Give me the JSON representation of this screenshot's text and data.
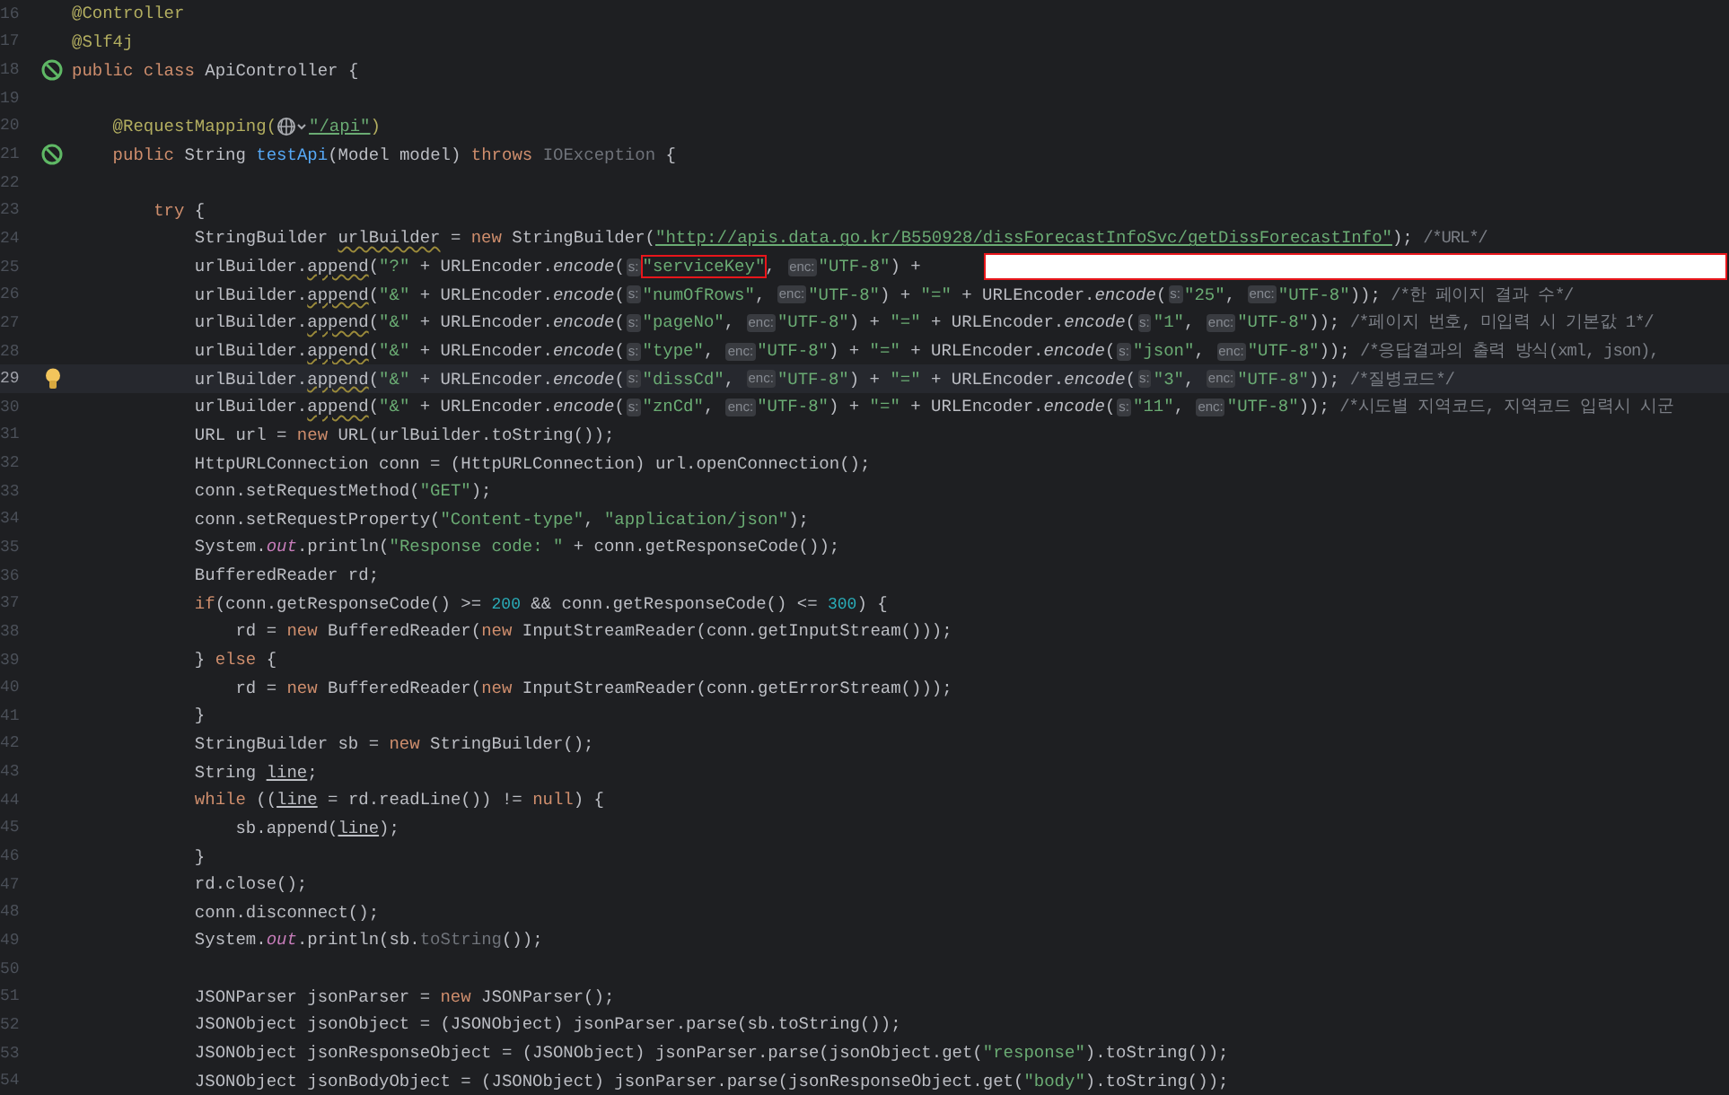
{
  "editor": {
    "lines": [
      {
        "number": "16",
        "current": false,
        "tokens": [
          {
            "kind": "ann",
            "text": "@Controller"
          }
        ]
      },
      {
        "number": "17",
        "current": false,
        "tokens": [
          {
            "kind": "ann",
            "text": "@Slf4j"
          }
        ]
      },
      {
        "number": "18",
        "current": false,
        "kind": "bean",
        "tokens": [
          {
            "kind": "kw",
            "text": "public class "
          },
          {
            "kind": "plain",
            "text": "ApiController {"
          }
        ]
      },
      {
        "number": "19",
        "current": false
      },
      {
        "number": "20",
        "current": false,
        "tokens": [
          {
            "kind": "ann",
            "text": "    @RequestMapping("
          },
          {
            "kind": "globe"
          },
          {
            "kind": "link",
            "text": "\"/api\""
          },
          {
            "kind": "ann",
            "text": ")"
          }
        ]
      },
      {
        "number": "21",
        "current": false,
        "kind": "bean",
        "tokens": [
          {
            "kind": "kw",
            "text": "    public "
          },
          {
            "kind": "plain",
            "text": "String "
          },
          {
            "kind": "fn",
            "text": "testApi"
          },
          {
            "kind": "plain",
            "text": "(Model model) "
          },
          {
            "kind": "kw",
            "text": "throws "
          },
          {
            "kind": "dim",
            "text": "IOException"
          },
          {
            "kind": "plain",
            "text": " {"
          }
        ]
      },
      {
        "number": "22",
        "current": false
      },
      {
        "number": "23",
        "current": false,
        "tokens": [
          {
            "kind": "kw",
            "text": "        try "
          },
          {
            "kind": "plain",
            "text": "{"
          }
        ]
      },
      {
        "number": "24",
        "current": false,
        "tokens": [
          {
            "kind": "plain",
            "text": "            StringBuilder "
          },
          {
            "kind": "warn",
            "text": "urlBuilder"
          },
          {
            "kind": "plain",
            "text": " = "
          },
          {
            "kind": "kw",
            "text": "new "
          },
          {
            "kind": "plain",
            "text": "StringBuilder("
          },
          {
            "kind": "link",
            "text": "\"http://apis.data.go.kr/B550928/dissForecastInfoSvc/getDissForecastInfo\""
          },
          {
            "kind": "plain",
            "text": "); "
          },
          {
            "kind": "com",
            "text": "/*URL*/"
          }
        ]
      },
      {
        "number": "25",
        "current": false,
        "redacted": true,
        "tokens": [
          {
            "kind": "plain",
            "text": "            urlBuilder."
          },
          {
            "kind": "warn",
            "text": "append"
          },
          {
            "kind": "plain",
            "text": "("
          },
          {
            "kind": "str",
            "text": "\"?\""
          },
          {
            "kind": "plain",
            "text": " + URLEncoder."
          },
          {
            "kind": "static",
            "text": "encode"
          },
          {
            "kind": "plain",
            "text": "("
          },
          {
            "kind": "hint",
            "text": "s:"
          },
          {
            "kind": "boxed",
            "text": "\"serviceKey\""
          },
          {
            "kind": "plain",
            "text": ", "
          },
          {
            "kind": "hint",
            "text": "enc:"
          },
          {
            "kind": "str",
            "text": "\"UTF-8\""
          },
          {
            "kind": "plain",
            "text": ") + "
          }
        ]
      },
      {
        "number": "26",
        "current": false,
        "tokens": [
          {
            "kind": "plain",
            "text": "            urlBuilder."
          },
          {
            "kind": "warn",
            "text": "append"
          },
          {
            "kind": "plain",
            "text": "("
          },
          {
            "kind": "str",
            "text": "\"&\""
          },
          {
            "kind": "plain",
            "text": " + URLEncoder."
          },
          {
            "kind": "static",
            "text": "encode"
          },
          {
            "kind": "plain",
            "text": "("
          },
          {
            "kind": "hint",
            "text": "s:"
          },
          {
            "kind": "str",
            "text": "\"numOfRows\""
          },
          {
            "kind": "plain",
            "text": ", "
          },
          {
            "kind": "hint",
            "text": "enc:"
          },
          {
            "kind": "str",
            "text": "\"UTF-8\""
          },
          {
            "kind": "plain",
            "text": ") + "
          },
          {
            "kind": "str",
            "text": "\"=\""
          },
          {
            "kind": "plain",
            "text": " + URLEncoder."
          },
          {
            "kind": "static",
            "text": "encode"
          },
          {
            "kind": "plain",
            "text": "("
          },
          {
            "kind": "hint",
            "text": "s:"
          },
          {
            "kind": "str",
            "text": "\"25\""
          },
          {
            "kind": "plain",
            "text": ", "
          },
          {
            "kind": "hint",
            "text": "enc:"
          },
          {
            "kind": "str",
            "text": "\"UTF-8\""
          },
          {
            "kind": "plain",
            "text": ")); "
          },
          {
            "kind": "com",
            "text": "/*한 페이지 결과 수*/"
          }
        ]
      },
      {
        "number": "27",
        "current": false,
        "tokens": [
          {
            "kind": "plain",
            "text": "            urlBuilder."
          },
          {
            "kind": "warn",
            "text": "append"
          },
          {
            "kind": "plain",
            "text": "("
          },
          {
            "kind": "str",
            "text": "\"&\""
          },
          {
            "kind": "plain",
            "text": " + URLEncoder."
          },
          {
            "kind": "static",
            "text": "encode"
          },
          {
            "kind": "plain",
            "text": "("
          },
          {
            "kind": "hint",
            "text": "s:"
          },
          {
            "kind": "str",
            "text": "\"pageNo\""
          },
          {
            "kind": "plain",
            "text": ", "
          },
          {
            "kind": "hint",
            "text": "enc:"
          },
          {
            "kind": "str",
            "text": "\"UTF-8\""
          },
          {
            "kind": "plain",
            "text": ") + "
          },
          {
            "kind": "str",
            "text": "\"=\""
          },
          {
            "kind": "plain",
            "text": " + URLEncoder."
          },
          {
            "kind": "static",
            "text": "encode"
          },
          {
            "kind": "plain",
            "text": "("
          },
          {
            "kind": "hint",
            "text": "s:"
          },
          {
            "kind": "str",
            "text": "\"1\""
          },
          {
            "kind": "plain",
            "text": ", "
          },
          {
            "kind": "hint",
            "text": "enc:"
          },
          {
            "kind": "str",
            "text": "\"UTF-8\""
          },
          {
            "kind": "plain",
            "text": ")); "
          },
          {
            "kind": "com",
            "text": "/*페이지 번호, 미입력 시 기본값 1*/"
          }
        ]
      },
      {
        "number": "28",
        "current": false,
        "tokens": [
          {
            "kind": "plain",
            "text": "            urlBuilder."
          },
          {
            "kind": "warn",
            "text": "append"
          },
          {
            "kind": "plain",
            "text": "("
          },
          {
            "kind": "str",
            "text": "\"&\""
          },
          {
            "kind": "plain",
            "text": " + URLEncoder."
          },
          {
            "kind": "static",
            "text": "encode"
          },
          {
            "kind": "plain",
            "text": "("
          },
          {
            "kind": "hint",
            "text": "s:"
          },
          {
            "kind": "str",
            "text": "\"type\""
          },
          {
            "kind": "plain",
            "text": ", "
          },
          {
            "kind": "hint",
            "text": "enc:"
          },
          {
            "kind": "str",
            "text": "\"UTF-8\""
          },
          {
            "kind": "plain",
            "text": ") + "
          },
          {
            "kind": "str",
            "text": "\"=\""
          },
          {
            "kind": "plain",
            "text": " + URLEncoder."
          },
          {
            "kind": "static",
            "text": "encode"
          },
          {
            "kind": "plain",
            "text": "("
          },
          {
            "kind": "hint",
            "text": "s:"
          },
          {
            "kind": "str",
            "text": "\"json\""
          },
          {
            "kind": "plain",
            "text": ", "
          },
          {
            "kind": "hint",
            "text": "enc:"
          },
          {
            "kind": "str",
            "text": "\"UTF-8\""
          },
          {
            "kind": "plain",
            "text": ")); "
          },
          {
            "kind": "com",
            "text": "/*응답결과의 출력 방식(xml, json),"
          }
        ]
      },
      {
        "number": "29",
        "current": true,
        "kind": "bulb",
        "tokens": [
          {
            "kind": "plain",
            "text": "            urlBuilder."
          },
          {
            "kind": "warn",
            "text": "append"
          },
          {
            "kind": "plain",
            "text": "("
          },
          {
            "kind": "str",
            "text": "\"&\""
          },
          {
            "kind": "plain",
            "text": " + URLEncoder."
          },
          {
            "kind": "static",
            "text": "encode"
          },
          {
            "kind": "plain",
            "text": "("
          },
          {
            "kind": "hint",
            "text": "s:"
          },
          {
            "kind": "str",
            "text": "\"dissCd\""
          },
          {
            "kind": "plain",
            "text": ", "
          },
          {
            "kind": "hint",
            "text": "enc:"
          },
          {
            "kind": "str",
            "text": "\"UTF-8\""
          },
          {
            "kind": "plain",
            "text": ") + "
          },
          {
            "kind": "str",
            "text": "\"=\""
          },
          {
            "kind": "plain",
            "text": " + URLEncoder."
          },
          {
            "kind": "static",
            "text": "encode"
          },
          {
            "kind": "plain",
            "text": "("
          },
          {
            "kind": "hint",
            "text": "s:"
          },
          {
            "kind": "str",
            "text": "\"3\""
          },
          {
            "kind": "plain",
            "text": ", "
          },
          {
            "kind": "hint",
            "text": "enc:"
          },
          {
            "kind": "str",
            "text": "\"UTF-8\""
          },
          {
            "kind": "plain",
            "text": ")); "
          },
          {
            "kind": "com",
            "text": "/*질병코드*/"
          }
        ]
      },
      {
        "number": "30",
        "current": false,
        "tokens": [
          {
            "kind": "plain",
            "text": "            urlBuilder."
          },
          {
            "kind": "warn",
            "text": "append"
          },
          {
            "kind": "plain",
            "text": "("
          },
          {
            "kind": "str",
            "text": "\"&\""
          },
          {
            "kind": "plain",
            "text": " + URLEncoder."
          },
          {
            "kind": "static",
            "text": "encode"
          },
          {
            "kind": "plain",
            "text": "("
          },
          {
            "kind": "hint",
            "text": "s:"
          },
          {
            "kind": "str",
            "text": "\"znCd\""
          },
          {
            "kind": "plain",
            "text": ", "
          },
          {
            "kind": "hint",
            "text": "enc:"
          },
          {
            "kind": "str",
            "text": "\"UTF-8\""
          },
          {
            "kind": "plain",
            "text": ") + "
          },
          {
            "kind": "str",
            "text": "\"=\""
          },
          {
            "kind": "plain",
            "text": " + URLEncoder."
          },
          {
            "kind": "static",
            "text": "encode"
          },
          {
            "kind": "plain",
            "text": "("
          },
          {
            "kind": "hint",
            "text": "s:"
          },
          {
            "kind": "str",
            "text": "\"11\""
          },
          {
            "kind": "plain",
            "text": ", "
          },
          {
            "kind": "hint",
            "text": "enc:"
          },
          {
            "kind": "str",
            "text": "\"UTF-8\""
          },
          {
            "kind": "plain",
            "text": ")); "
          },
          {
            "kind": "com",
            "text": "/*시도별 지역코드, 지역코드 입력시 시군"
          }
        ]
      },
      {
        "number": "31",
        "current": false,
        "tokens": [
          {
            "kind": "plain",
            "text": "            URL url = "
          },
          {
            "kind": "kw",
            "text": "new "
          },
          {
            "kind": "plain",
            "text": "URL(urlBuilder.toString());"
          }
        ]
      },
      {
        "number": "32",
        "current": false,
        "tokens": [
          {
            "kind": "plain",
            "text": "            HttpURLConnection conn = (HttpURLConnection) url.openConnection();"
          }
        ]
      },
      {
        "number": "33",
        "current": false,
        "tokens": [
          {
            "kind": "plain",
            "text": "            conn.setRequestMethod("
          },
          {
            "kind": "str",
            "text": "\"GET\""
          },
          {
            "kind": "plain",
            "text": ");"
          }
        ]
      },
      {
        "number": "34",
        "current": false,
        "tokens": [
          {
            "kind": "plain",
            "text": "            conn.setRequestProperty("
          },
          {
            "kind": "str",
            "text": "\"Content-type\""
          },
          {
            "kind": "plain",
            "text": ", "
          },
          {
            "kind": "str",
            "text": "\"application/json\""
          },
          {
            "kind": "plain",
            "text": ");"
          }
        ]
      },
      {
        "number": "35",
        "current": false,
        "tokens": [
          {
            "kind": "plain",
            "text": "            System."
          },
          {
            "kind": "field",
            "text": "out"
          },
          {
            "kind": "plain",
            "text": ".println("
          },
          {
            "kind": "str",
            "text": "\"Response code: \""
          },
          {
            "kind": "plain",
            "text": " + conn.getResponseCode());"
          }
        ]
      },
      {
        "number": "36",
        "current": false,
        "tokens": [
          {
            "kind": "plain",
            "text": "            BufferedReader rd;"
          }
        ]
      },
      {
        "number": "37",
        "current": false,
        "tokens": [
          {
            "kind": "kw",
            "text": "            if"
          },
          {
            "kind": "plain",
            "text": "(conn.getResponseCode() >= "
          },
          {
            "kind": "num",
            "text": "200"
          },
          {
            "kind": "plain",
            "text": " && conn.getResponseCode() <= "
          },
          {
            "kind": "num",
            "text": "300"
          },
          {
            "kind": "plain",
            "text": ") {"
          }
        ]
      },
      {
        "number": "38",
        "current": false,
        "tokens": [
          {
            "kind": "plain",
            "text": "                rd = "
          },
          {
            "kind": "kw",
            "text": "new "
          },
          {
            "kind": "plain",
            "text": "BufferedReader("
          },
          {
            "kind": "kw",
            "text": "new "
          },
          {
            "kind": "plain",
            "text": "InputStreamReader(conn.getInputStream()));"
          }
        ]
      },
      {
        "number": "39",
        "current": false,
        "tokens": [
          {
            "kind": "plain",
            "text": "            } "
          },
          {
            "kind": "kw",
            "text": "else "
          },
          {
            "kind": "plain",
            "text": "{"
          }
        ]
      },
      {
        "number": "40",
        "current": false,
        "tokens": [
          {
            "kind": "plain",
            "text": "                rd = "
          },
          {
            "kind": "kw",
            "text": "new "
          },
          {
            "kind": "plain",
            "text": "BufferedReader("
          },
          {
            "kind": "kw",
            "text": "new "
          },
          {
            "kind": "plain",
            "text": "InputStreamReader(conn.getErrorStream()));"
          }
        ]
      },
      {
        "number": "41",
        "current": false,
        "tokens": [
          {
            "kind": "plain",
            "text": "            }"
          }
        ]
      },
      {
        "number": "42",
        "current": false,
        "tokens": [
          {
            "kind": "plain",
            "text": "            StringBuilder sb = "
          },
          {
            "kind": "kw",
            "text": "new "
          },
          {
            "kind": "plain",
            "text": "StringBuilder();"
          }
        ]
      },
      {
        "number": "43",
        "current": false,
        "tokens": [
          {
            "kind": "plain",
            "text": "            String "
          },
          {
            "kind": "ul",
            "text": "line"
          },
          {
            "kind": "plain",
            "text": ";"
          }
        ]
      },
      {
        "number": "44",
        "current": false,
        "tokens": [
          {
            "kind": "kw",
            "text": "            while "
          },
          {
            "kind": "plain",
            "text": "(("
          },
          {
            "kind": "ul",
            "text": "line"
          },
          {
            "kind": "plain",
            "text": " = rd.readLine()) != "
          },
          {
            "kind": "kw",
            "text": "null"
          },
          {
            "kind": "plain",
            "text": ") {"
          }
        ]
      },
      {
        "number": "45",
        "current": false,
        "tokens": [
          {
            "kind": "plain",
            "text": "                sb.append("
          },
          {
            "kind": "ul",
            "text": "line"
          },
          {
            "kind": "plain",
            "text": ");"
          }
        ]
      },
      {
        "number": "46",
        "current": false,
        "tokens": [
          {
            "kind": "plain",
            "text": "            }"
          }
        ]
      },
      {
        "number": "47",
        "current": false,
        "tokens": [
          {
            "kind": "plain",
            "text": "            rd.close();"
          }
        ]
      },
      {
        "number": "48",
        "current": false,
        "tokens": [
          {
            "kind": "plain",
            "text": "            conn.disconnect();"
          }
        ]
      },
      {
        "number": "49",
        "current": false,
        "tokens": [
          {
            "kind": "plain",
            "text": "            System."
          },
          {
            "kind": "field",
            "text": "out"
          },
          {
            "kind": "plain",
            "text": ".println(sb."
          },
          {
            "kind": "dim",
            "text": "toString"
          },
          {
            "kind": "plain",
            "text": "());"
          }
        ]
      },
      {
        "number": "50",
        "current": false
      },
      {
        "number": "51",
        "current": false,
        "tokens": [
          {
            "kind": "plain",
            "text": "            JSONParser jsonParser = "
          },
          {
            "kind": "kw",
            "text": "new "
          },
          {
            "kind": "plain",
            "text": "JSONParser();"
          }
        ]
      },
      {
        "number": "52",
        "current": false,
        "tokens": [
          {
            "kind": "plain",
            "text": "            JSONObject jsonObject = (JSONObject) jsonParser.parse(sb.toString());"
          }
        ]
      },
      {
        "number": "53",
        "current": false,
        "tokens": [
          {
            "kind": "plain",
            "text": "            JSONObject jsonResponseObject = (JSONObject) jsonParser.parse(jsonObject.get("
          },
          {
            "kind": "str",
            "text": "\"response\""
          },
          {
            "kind": "plain",
            "text": ").toString());"
          }
        ]
      },
      {
        "number": "54",
        "current": false,
        "tokens": [
          {
            "kind": "plain",
            "text": "            JSONObject jsonBodyObject = (JSONObject) jsonParser.parse(jsonResponseObject.get("
          },
          {
            "kind": "str",
            "text": "\"body\""
          },
          {
            "kind": "plain",
            "text": ").toString());"
          }
        ]
      }
    ]
  }
}
